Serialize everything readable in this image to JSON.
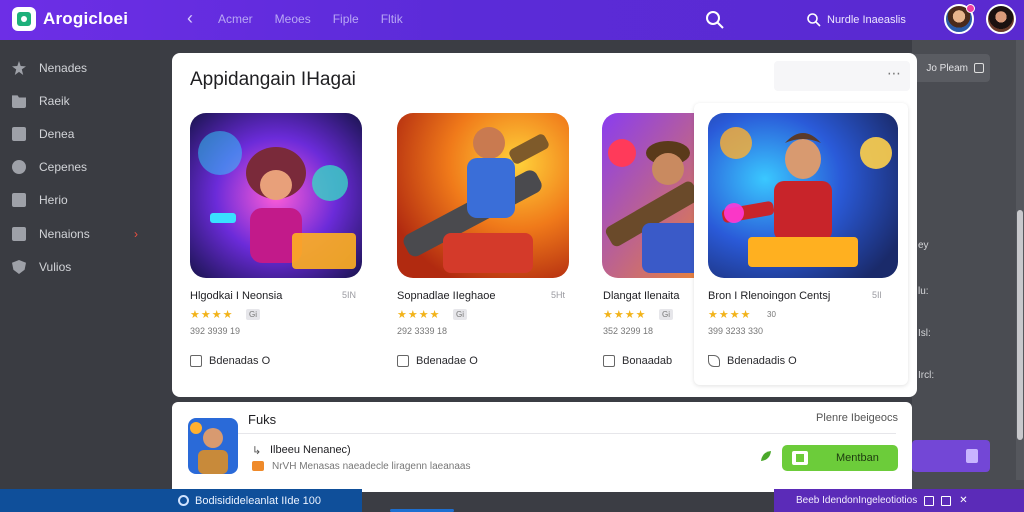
{
  "app": {
    "logo_text": "Arogicloei",
    "nav": [
      "Acmer",
      "Meoes",
      "Fiple",
      "Fltik"
    ],
    "search_placeholder": "Nurdle Inaeaslis"
  },
  "sidebar": {
    "items": [
      {
        "label": "Nenades",
        "icon": "star-icon"
      },
      {
        "label": "Raeik",
        "icon": "folder-icon"
      },
      {
        "label": "Denea",
        "icon": "grid-icon"
      },
      {
        "label": "Cepenes",
        "icon": "gear-icon"
      },
      {
        "label": "Herio",
        "icon": "document-icon"
      },
      {
        "label": "Nenaions",
        "icon": "message-icon",
        "alert": "›"
      },
      {
        "label": "Vulios",
        "icon": "shield-icon"
      }
    ]
  },
  "panel": {
    "title": "Appidangain IHagai",
    "menu_dots": "⋯",
    "games": [
      {
        "title": "Hlgodkai I Neonsia",
        "size": "5IN",
        "stars": "★★★★",
        "rating": "Gi",
        "downloads": "392 3939 19",
        "check_label": "Bdenadas O"
      },
      {
        "title": "Sopnadlae IIeghaoe",
        "size": "5Ht",
        "stars": "★★★★",
        "rating": "Gi",
        "downloads": "292 3339 18",
        "check_label": "Bdenadae O"
      },
      {
        "title": "Dlangat Ilenaita",
        "size": "",
        "stars": "★★★★",
        "rating": "Gi",
        "downloads": "352 3299 18",
        "check_label": "Bonaadab"
      },
      {
        "title": "Bron I Rlenoingon Centsj",
        "size": "5Il",
        "stars": "★★★★",
        "rating": "30",
        "downloads": "399 3233 330",
        "check_label": "Bdenadadis O"
      }
    ]
  },
  "right": {
    "filter_label": "Jo Pleam",
    "labels": [
      "ey",
      "lu:",
      "Isl:",
      "Ircl:"
    ]
  },
  "list": {
    "header": "Fuks",
    "more": "Plenre Ibeigeocs",
    "item_name": "Ilbeeu Nenanec)",
    "item_desc": "NrVH Menasas naeadecle liragenn laeanaas",
    "install_label": "Mentban"
  },
  "status": {
    "left_text": "Bodisidideleanlat IIde  100",
    "right_text": "Beeb IdendonIngeleotiotios"
  },
  "colors": {
    "topbar": "#6d2ee6",
    "accent_green": "#6ccc3a",
    "star": "#f2b31a"
  }
}
